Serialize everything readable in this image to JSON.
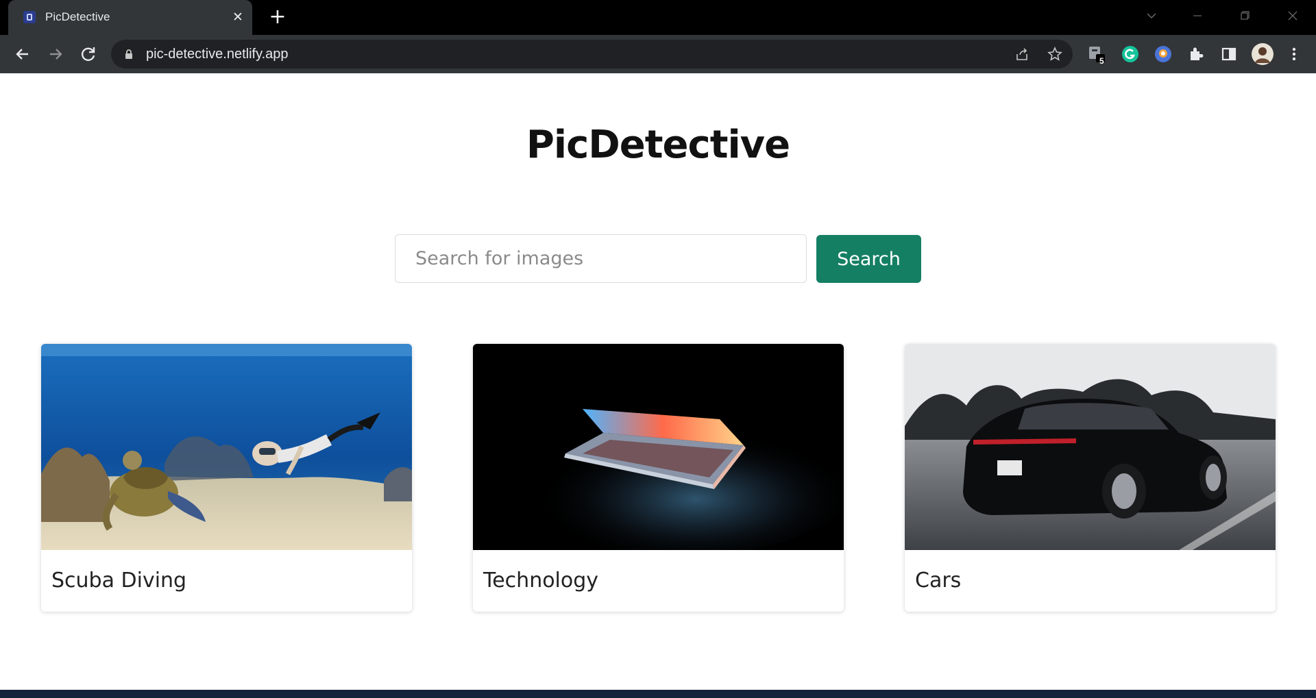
{
  "browser": {
    "tab_title": "PicDetective",
    "url": "pic-detective.netlify.app",
    "extension_badge": "5"
  },
  "app": {
    "title": "PicDetective",
    "search": {
      "placeholder": "Search for images",
      "value": "",
      "button_label": "Search",
      "button_color": "#157f63"
    },
    "categories": [
      {
        "label": "Scuba Diving",
        "image": "underwater scene with sea turtle and diver"
      },
      {
        "label": "Technology",
        "image": "partially open laptop glowing in the dark"
      },
      {
        "label": "Cars",
        "image": "black Porsche sedan driving on a highway"
      }
    ]
  }
}
